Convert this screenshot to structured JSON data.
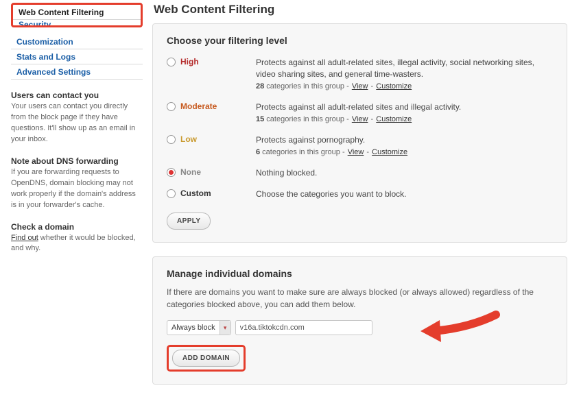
{
  "sidebar": {
    "nav": {
      "active": "Web Content Filtering",
      "items": [
        "Customization",
        "Stats and Logs",
        "Advanced Settings"
      ]
    },
    "blocks": [
      {
        "title": "Users can contact you",
        "body": "Your users can contact you directly from the block page if they have questions. It'll show up as an email in your inbox."
      },
      {
        "title": "Note about DNS forwarding",
        "body": "If you are forwarding requests to OpenDNS, domain blocking may not work properly if the domain's address is in your forwarder's cache."
      },
      {
        "title": "Check a domain",
        "link_text": "Find out",
        "body_after": " whether it would be blocked, and why."
      }
    ]
  },
  "page": {
    "title": "Web Content Filtering",
    "filtering": {
      "heading": "Choose your filtering level",
      "selected": "None",
      "levels": [
        {
          "key": "high",
          "name": "High",
          "desc": "Protects against all adult-related sites, illegal activity, social networking sites, video sharing sites, and general time-wasters.",
          "count": "28",
          "count_label": " categories in this group - ",
          "view": "View",
          "sep": " - ",
          "customize": "Customize"
        },
        {
          "key": "moderate",
          "name": "Moderate",
          "desc": "Protects against all adult-related sites and illegal activity.",
          "count": "15",
          "count_label": " categories in this group - ",
          "view": "View",
          "sep": " - ",
          "customize": "Customize"
        },
        {
          "key": "low",
          "name": "Low",
          "desc": "Protects against pornography.",
          "count": "6",
          "count_label": " categories in this group - ",
          "view": "View",
          "sep": " - ",
          "customize": "Customize"
        },
        {
          "key": "none",
          "name": "None",
          "desc": "Nothing blocked."
        },
        {
          "key": "custom",
          "name": "Custom",
          "desc": "Choose the categories you want to block."
        }
      ],
      "apply_label": "APPLY"
    },
    "manage": {
      "heading": "Manage individual domains",
      "desc": "If there are domains you want to make sure are always blocked (or always allowed) regardless of the categories blocked above, you can add them below.",
      "action_select": "Always block",
      "domain_value": "v16a.tiktokcdn.com",
      "add_label": "ADD DOMAIN"
    }
  }
}
